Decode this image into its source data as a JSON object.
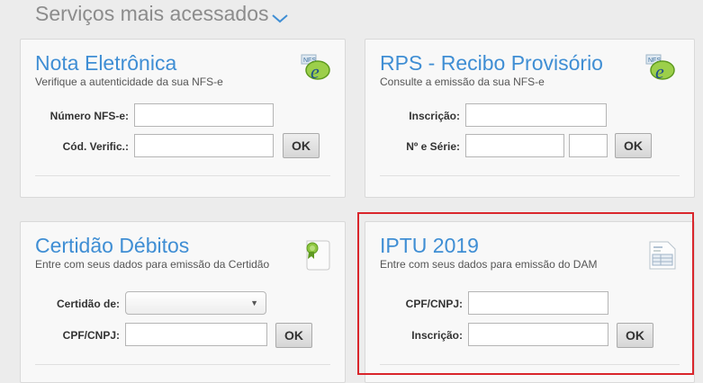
{
  "section": {
    "title": "Serviços mais acessados",
    "chevron_icon": "chevron-down-icon"
  },
  "cards": {
    "nota": {
      "title": "Nota Eletrônica",
      "subtitle": "Verifique a autenticidade da sua NFS-e",
      "icon": "nfse-logo-icon",
      "fields": [
        {
          "label": "Número NFS-e:",
          "value": ""
        },
        {
          "label": "Cód. Verific.:",
          "value": ""
        }
      ],
      "button": "OK"
    },
    "rps": {
      "title": "RPS - Recibo Provisório",
      "subtitle": "Consulte a emissão da sua NFS-e",
      "icon": "nfse-logo-icon",
      "fields": [
        {
          "label": "Inscrição:",
          "value": ""
        },
        {
          "label": "Nº e Série:",
          "value": "",
          "serie": ""
        }
      ],
      "button": "OK"
    },
    "certidao": {
      "title": "Certidão Débitos",
      "subtitle": "Entre com seus dados para emissão da Certidão",
      "icon": "certificate-icon",
      "fields": [
        {
          "label": "Certidão de:",
          "selected": ""
        },
        {
          "label": "CPF/CNPJ:",
          "value": ""
        }
      ],
      "button": "OK"
    },
    "iptu": {
      "title": "IPTU 2019",
      "subtitle": "Entre com seus dados para emissão do DAM",
      "icon": "document-icon",
      "fields": [
        {
          "label": "CPF/CNPJ:",
          "value": ""
        },
        {
          "label": "Inscrição:",
          "value": ""
        }
      ],
      "button": "OK"
    }
  },
  "colors": {
    "title_blue": "#3f8ed4",
    "highlight_red": "#d9252b",
    "background": "#ececec"
  }
}
